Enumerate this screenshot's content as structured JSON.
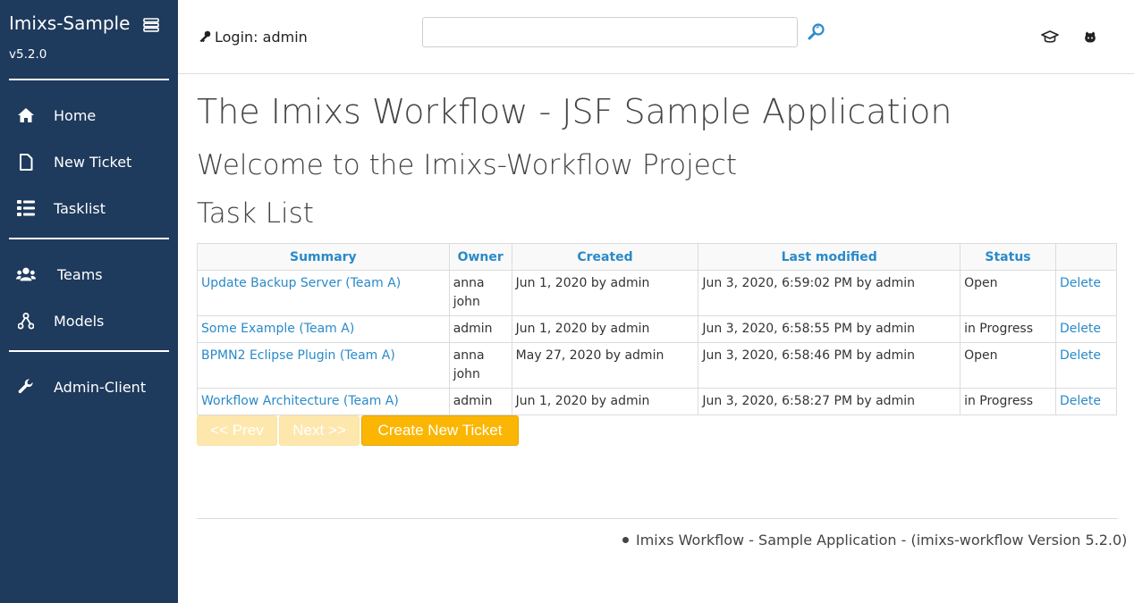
{
  "sidebar": {
    "brand": "Imixs-Sample",
    "version": "v5.2.0",
    "items": [
      {
        "label": "Home",
        "icon": "home-icon"
      },
      {
        "label": "New Ticket",
        "icon": "file-icon"
      },
      {
        "label": "Tasklist",
        "icon": "list-icon"
      },
      {
        "label": "Teams",
        "icon": "users-icon"
      },
      {
        "label": "Models",
        "icon": "sitemap-icon"
      },
      {
        "label": "Admin-Client",
        "icon": "wrench-icon"
      }
    ]
  },
  "header": {
    "login_label": "Login: admin",
    "search_value": "",
    "icons": [
      "search-icon",
      "graduation-cap-icon",
      "github-icon"
    ]
  },
  "main": {
    "title": "The Imixs Workflow - JSF Sample Application",
    "welcome": "Welcome to the Imixs-Workflow Project",
    "tasklist_heading": "Task List",
    "table": {
      "headers": [
        "Summary",
        "Owner",
        "Created",
        "Last modified",
        "Status",
        ""
      ],
      "rows": [
        {
          "summary": "Update Backup Server (Team A)",
          "owners": [
            "anna",
            "john"
          ],
          "created": "Jun 1, 2020 by admin",
          "modified": "Jun 3, 2020, 6:59:02 PM by admin",
          "status": "Open",
          "action": "Delete"
        },
        {
          "summary": "Some Example (Team A)",
          "owners": [
            "admin"
          ],
          "created": "Jun 1, 2020 by admin",
          "modified": "Jun 3, 2020, 6:58:55 PM by admin",
          "status": "in Progress",
          "action": "Delete"
        },
        {
          "summary": "BPMN2 Eclipse Plugin (Team A)",
          "owners": [
            "anna",
            "john"
          ],
          "created": "May 27, 2020 by admin",
          "modified": "Jun 3, 2020, 6:58:46 PM by admin",
          "status": "Open",
          "action": "Delete"
        },
        {
          "summary": "Workflow Architecture (Team A)",
          "owners": [
            "admin"
          ],
          "created": "Jun 1, 2020 by admin",
          "modified": "Jun 3, 2020, 6:58:27 PM by admin",
          "status": "in Progress",
          "action": "Delete"
        }
      ]
    },
    "buttons": {
      "prev": "<< Prev",
      "next": "Next >>",
      "create": "Create New Ticket"
    }
  },
  "footer": {
    "text": "Imixs Workflow - Sample Application - (imixs-workflow Version 5.2.0)"
  },
  "colors": {
    "sidebar_bg": "#1e3a5c",
    "link": "#2a8ac8",
    "accent": "#fbb603"
  }
}
